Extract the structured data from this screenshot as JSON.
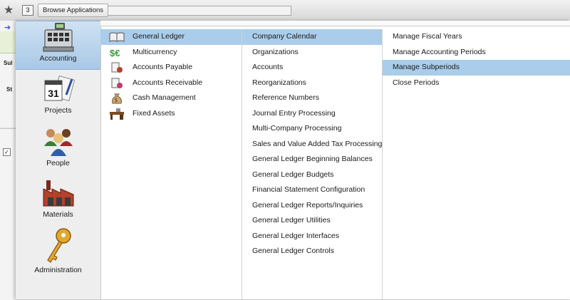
{
  "toolbar": {
    "tab_count": "3",
    "browse_label": "Browse Applications"
  },
  "background": {
    "sub1": "Sul",
    "sub2": "St",
    "check": "✓"
  },
  "categories": [
    {
      "label": "Accounting",
      "icon": "cash-register-icon",
      "selected": true
    },
    {
      "label": "Projects",
      "icon": "calendar-icon",
      "selected": false
    },
    {
      "label": "People",
      "icon": "people-icon",
      "selected": false
    },
    {
      "label": "Materials",
      "icon": "factory-icon",
      "selected": false
    },
    {
      "label": "Administration",
      "icon": "key-icon",
      "selected": false
    }
  ],
  "modules": [
    {
      "label": "General Ledger",
      "icon": "ledger-book-icon",
      "selected": true
    },
    {
      "label": "Multicurrency",
      "icon": "currency-icon",
      "selected": false
    },
    {
      "label": "Accounts Payable",
      "icon": "payable-icon",
      "selected": false
    },
    {
      "label": "Accounts Receivable",
      "icon": "receivable-icon",
      "selected": false
    },
    {
      "label": "Cash Management",
      "icon": "money-bag-icon",
      "selected": false
    },
    {
      "label": "Fixed Assets",
      "icon": "desk-icon",
      "selected": false
    }
  ],
  "gl_items": [
    "Company Calendar",
    "Organizations",
    "Accounts",
    "Reorganizations",
    "Reference Numbers",
    "Journal Entry Processing",
    "Multi-Company Processing",
    "Sales and Value Added Tax Processing",
    "General Ledger Beginning Balances",
    "General Ledger Budgets",
    "Financial Statement Configuration",
    "General Ledger Reports/Inquiries",
    "General Ledger Utilities",
    "General Ledger Interfaces",
    "General Ledger Controls"
  ],
  "calendar_items": [
    "Manage Fiscal Years",
    "Manage Accounting Periods",
    "Manage Subperiods",
    "Close Periods"
  ],
  "selection": {
    "gl_item": "Company Calendar",
    "calendar_item": "Manage Subperiods"
  },
  "colors": {
    "selection": "#a9cdea",
    "category_selected": "#b8d3ec"
  }
}
